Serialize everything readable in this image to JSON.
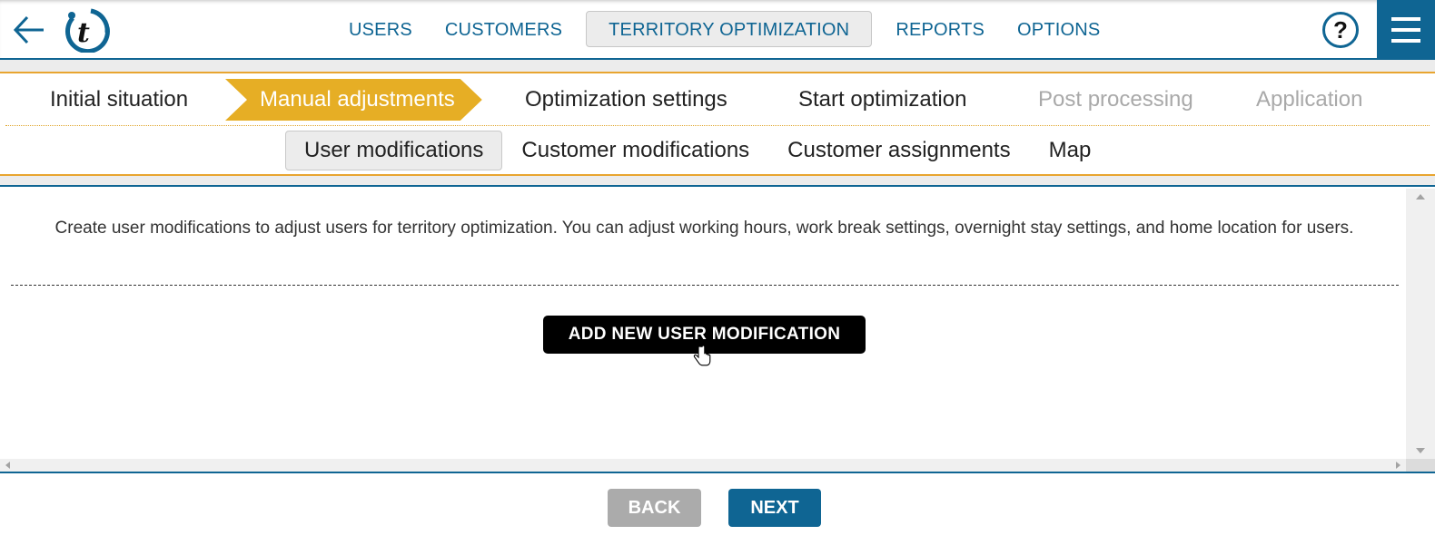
{
  "header": {
    "back_icon": "arrow-left-icon",
    "logo_icon": "t-logo-icon",
    "nav": [
      {
        "label": "USERS",
        "active": false
      },
      {
        "label": "CUSTOMERS",
        "active": false
      },
      {
        "label": "TERRITORY OPTIMIZATION",
        "active": true
      },
      {
        "label": "REPORTS",
        "active": false
      },
      {
        "label": "OPTIONS",
        "active": false
      }
    ],
    "help_label": "?",
    "menu_icon": "hamburger-icon"
  },
  "wizard": {
    "steps": [
      {
        "label": "Initial situation",
        "state": "done"
      },
      {
        "label": "Manual adjustments",
        "state": "current"
      },
      {
        "label": "Optimization settings",
        "state": "enabled"
      },
      {
        "label": "Start optimization",
        "state": "enabled"
      },
      {
        "label": "Post processing",
        "state": "disabled"
      },
      {
        "label": "Application",
        "state": "disabled"
      }
    ],
    "subtabs": [
      {
        "label": "User modifications",
        "active": true
      },
      {
        "label": "Customer modifications",
        "active": false
      },
      {
        "label": "Customer assignments",
        "active": false
      },
      {
        "label": "Map",
        "active": false
      }
    ]
  },
  "content": {
    "description": "Create user modifications to adjust users for territory optimization. You can adjust working hours, work break settings, overnight stay settings, and home location for users.",
    "add_button_label": "ADD NEW USER MODIFICATION"
  },
  "footer": {
    "back_label": "BACK",
    "next_label": "NEXT"
  },
  "colors": {
    "brand_blue": "#0f6593",
    "step_accent": "#e6ae25",
    "disabled_gray": "#ababab"
  }
}
